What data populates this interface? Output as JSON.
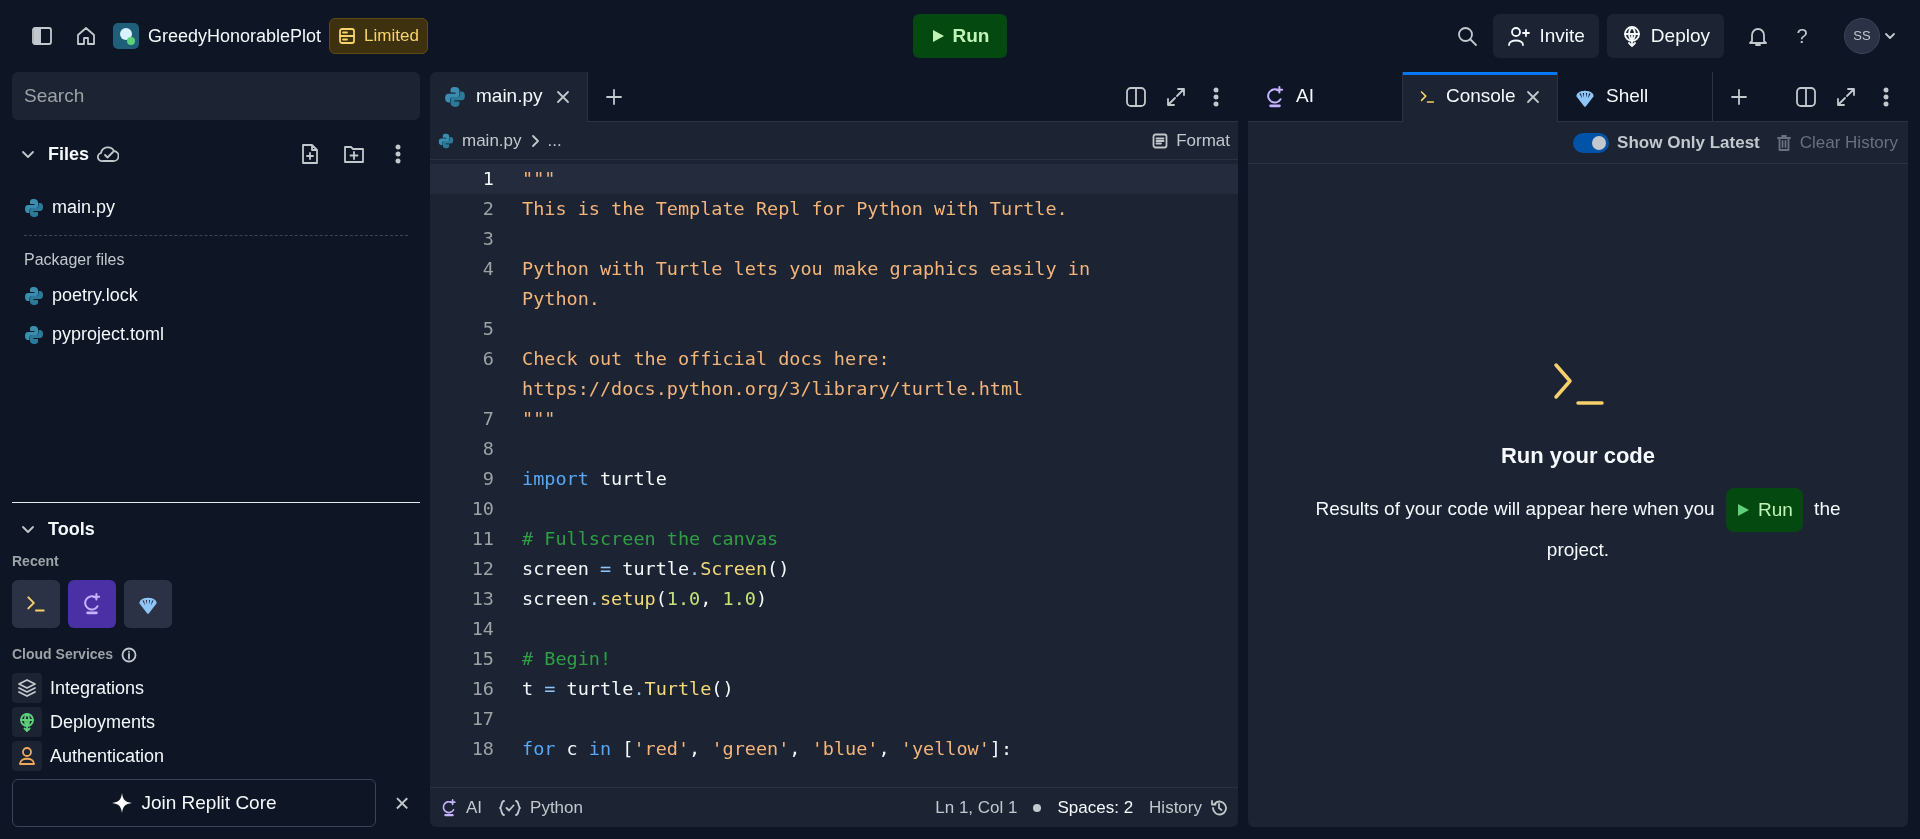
{
  "topbar": {
    "project_name": "GreedyHonorablePlot",
    "plan_badge": "Limited",
    "run_label": "Run",
    "invite_label": "Invite",
    "deploy_label": "Deploy",
    "help_label": "?",
    "avatar_initials": "SS"
  },
  "sidebar": {
    "search": {
      "placeholder": "Search"
    },
    "files_title": "Files",
    "files": [
      {
        "name": "main.py"
      }
    ],
    "packager_label": "Packager files",
    "packager_files": [
      {
        "name": "poetry.lock"
      },
      {
        "name": "pyproject.toml"
      }
    ],
    "tools_title": "Tools",
    "recent_label": "Recent",
    "recent_tools": [
      {
        "kind": "console",
        "selected": false
      },
      {
        "kind": "ai",
        "selected": true
      },
      {
        "kind": "shell",
        "selected": false
      }
    ],
    "cloud_label": "Cloud Services",
    "cloud_items": [
      {
        "kind": "integrations",
        "label": "Integrations"
      },
      {
        "kind": "deployments",
        "label": "Deployments"
      },
      {
        "kind": "authentication",
        "label": "Authentication"
      }
    ],
    "banner": {
      "label": "Join Replit Core",
      "close": "×"
    }
  },
  "editor": {
    "tabs": [
      {
        "label": "main.py",
        "selected": true,
        "closable": true
      }
    ],
    "breadcrumb": [
      "main.py",
      "..."
    ],
    "format_label": "Format",
    "lines": [
      {
        "n": "1",
        "current": true,
        "rows": [
          [
            {
              "kind": "string",
              "text": "\"\"\""
            }
          ]
        ]
      },
      {
        "n": "2",
        "current": false,
        "rows": [
          [
            {
              "kind": "string",
              "text": "This is the Template Repl for Python with Turtle."
            }
          ]
        ]
      },
      {
        "n": "3",
        "current": false,
        "rows": [
          []
        ]
      },
      {
        "n": "4",
        "current": false,
        "rows": [
          [
            {
              "kind": "string",
              "text": "Python with Turtle lets you make graphics easily in"
            }
          ],
          [
            {
              "kind": "string",
              "text": "Python."
            }
          ]
        ]
      },
      {
        "n": "5",
        "current": false,
        "rows": [
          []
        ]
      },
      {
        "n": "6",
        "current": false,
        "rows": [
          [
            {
              "kind": "string",
              "text": "Check out the official docs here:"
            }
          ],
          [
            {
              "kind": "string",
              "text": "https://docs.python.org/3/library/turtle.html"
            }
          ]
        ]
      },
      {
        "n": "7",
        "current": false,
        "rows": [
          [
            {
              "kind": "string",
              "text": "\"\"\""
            }
          ]
        ]
      },
      {
        "n": "8",
        "current": false,
        "rows": [
          []
        ]
      },
      {
        "n": "9",
        "current": false,
        "rows": [
          [
            {
              "kind": "keyword",
              "text": "import"
            },
            {
              "kind": "plain",
              "text": " turtle"
            }
          ]
        ]
      },
      {
        "n": "10",
        "current": false,
        "rows": [
          []
        ]
      },
      {
        "n": "11",
        "current": false,
        "rows": [
          [
            {
              "kind": "comment",
              "text": "# Fullscreen the canvas"
            }
          ]
        ]
      },
      {
        "n": "12",
        "current": false,
        "rows": [
          [
            {
              "kind": "plain",
              "text": "screen "
            },
            {
              "kind": "operator",
              "text": "="
            },
            {
              "kind": "plain",
              "text": " turtle"
            },
            {
              "kind": "operator",
              "text": "."
            },
            {
              "kind": "func",
              "text": "Screen"
            },
            {
              "kind": "plain",
              "text": "()"
            }
          ]
        ]
      },
      {
        "n": "13",
        "current": false,
        "rows": [
          [
            {
              "kind": "plain",
              "text": "screen"
            },
            {
              "kind": "operator",
              "text": "."
            },
            {
              "kind": "func",
              "text": "setup"
            },
            {
              "kind": "plain",
              "text": "("
            },
            {
              "kind": "number",
              "text": "1.0"
            },
            {
              "kind": "plain",
              "text": ", "
            },
            {
              "kind": "number",
              "text": "1.0"
            },
            {
              "kind": "plain",
              "text": ")"
            }
          ]
        ]
      },
      {
        "n": "14",
        "current": false,
        "rows": [
          []
        ]
      },
      {
        "n": "15",
        "current": false,
        "rows": [
          [
            {
              "kind": "comment",
              "text": "# Begin!"
            }
          ]
        ]
      },
      {
        "n": "16",
        "current": false,
        "rows": [
          [
            {
              "kind": "plain",
              "text": "t "
            },
            {
              "kind": "operator",
              "text": "="
            },
            {
              "kind": "plain",
              "text": " turtle"
            },
            {
              "kind": "operator",
              "text": "."
            },
            {
              "kind": "func",
              "text": "Turtle"
            },
            {
              "kind": "plain",
              "text": "()"
            }
          ]
        ]
      },
      {
        "n": "17",
        "current": false,
        "rows": [
          []
        ]
      },
      {
        "n": "18",
        "current": false,
        "rows": [
          [
            {
              "kind": "keyword",
              "text": "for"
            },
            {
              "kind": "plain",
              "text": " c "
            },
            {
              "kind": "keyword",
              "text": "in"
            },
            {
              "kind": "plain",
              "text": " ["
            },
            {
              "kind": "string",
              "text": "'red'"
            },
            {
              "kind": "plain",
              "text": ", "
            },
            {
              "kind": "string",
              "text": "'green'"
            },
            {
              "kind": "plain",
              "text": ", "
            },
            {
              "kind": "string",
              "text": "'blue'"
            },
            {
              "kind": "plain",
              "text": ", "
            },
            {
              "kind": "string",
              "text": "'yellow'"
            },
            {
              "kind": "plain",
              "text": "]:"
            }
          ]
        ]
      }
    ],
    "status": {
      "ai": "AI",
      "language": "Python",
      "position": "Ln 1, Col 1",
      "spaces": "Spaces: 2",
      "history": "History"
    }
  },
  "console": {
    "tabs": [
      {
        "kind": "ai",
        "label": "AI",
        "selected": false,
        "closable": false
      },
      {
        "kind": "console",
        "label": "Console",
        "selected": true,
        "closable": true
      },
      {
        "kind": "shell",
        "label": "Shell",
        "selected": false,
        "closable": false
      }
    ],
    "toggle": {
      "label": "Show Only Latest",
      "on": true
    },
    "clear": {
      "label": "Clear History",
      "disabled": true
    },
    "empty_title": "Run your code",
    "empty_text_before": "Results of your code will appear here when you",
    "empty_run": "Run",
    "empty_text_after": "the project."
  }
}
